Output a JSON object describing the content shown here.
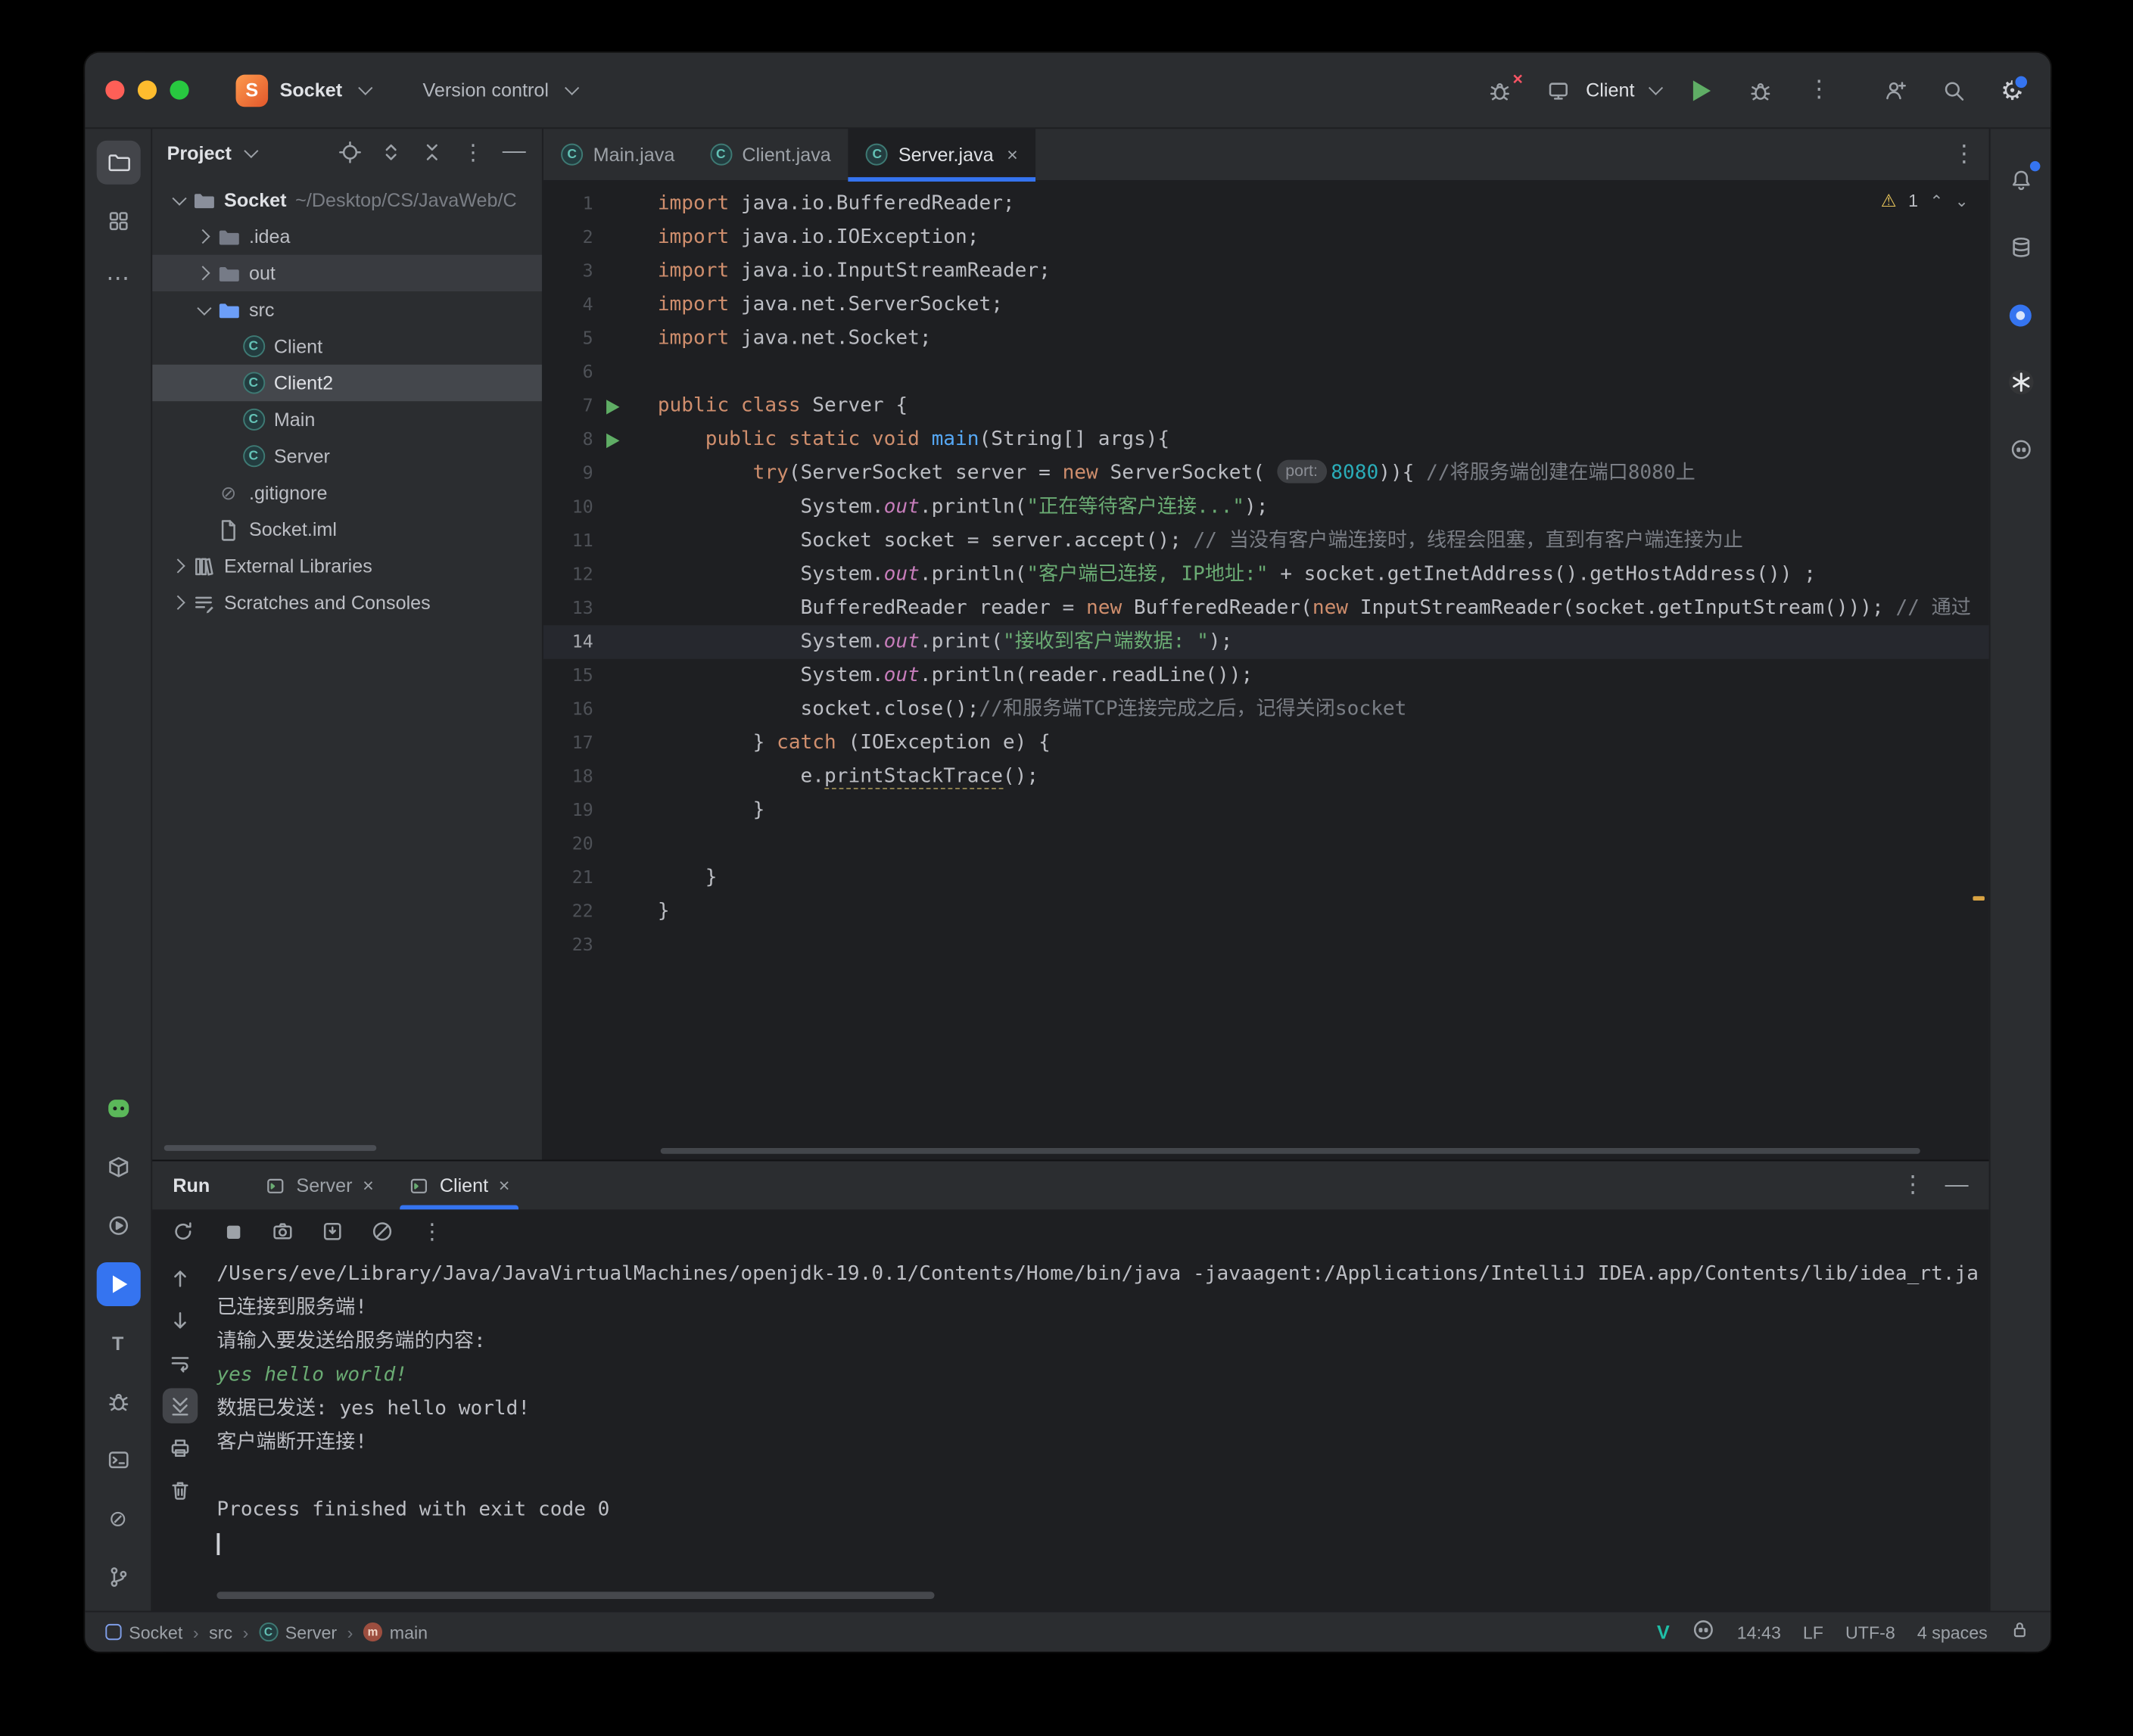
{
  "titlebar": {
    "project": "Socket",
    "vcs": "Version control",
    "run_config": "Client"
  },
  "stripes": {
    "left_top": [
      {
        "name": "project-tool-button",
        "icon": "folder-tool",
        "active": "gray"
      },
      {
        "name": "structure-tool-button",
        "icon": "structure"
      },
      {
        "name": "more-tools-button",
        "icon": "more-h"
      }
    ],
    "left_bottom": [
      {
        "name": "ai-assistant-icon",
        "icon": "mascot"
      },
      {
        "name": "dependencies-icon",
        "icon": "box"
      },
      {
        "name": "services-tool-button",
        "icon": "play-circle"
      },
      {
        "name": "run-tool-button",
        "icon": "play-solid",
        "active": "blue"
      },
      {
        "name": "todo-tool-button",
        "icon": "letter-t"
      },
      {
        "name": "debug-tool-button",
        "icon": "bug"
      },
      {
        "name": "terminal-tool-button",
        "icon": "terminal"
      },
      {
        "name": "problems-tool-button",
        "icon": "problem"
      },
      {
        "name": "git-tool-button",
        "icon": "branch"
      }
    ],
    "right": [
      {
        "name": "notifications-button",
        "icon": "bell",
        "badge": true
      },
      {
        "name": "database-tool-button",
        "icon": "database"
      },
      {
        "name": "plugin-blue-icon",
        "icon": "blue-circle"
      },
      {
        "name": "ai-chat-plugin-icon",
        "icon": "openai"
      },
      {
        "name": "copilot-plugin-icon",
        "icon": "copilot"
      }
    ]
  },
  "project_panel": {
    "title": "Project",
    "header_icons": [
      {
        "name": "locate-file-button",
        "icon": "target"
      },
      {
        "name": "expand-all-button",
        "icon": "expand"
      },
      {
        "name": "collapse-all-button",
        "icon": "collapse"
      },
      {
        "name": "project-options-button",
        "icon": "more-v"
      },
      {
        "name": "hide-panel-button",
        "icon": "minus"
      }
    ],
    "tree": [
      {
        "label": "Socket",
        "suffix": "~/Desktop/CS/JavaWeb/C",
        "depth": 0,
        "chevron": "open",
        "icon": "folder-root",
        "bold": true
      },
      {
        "label": ".idea",
        "depth": 1,
        "chevron": "closed",
        "icon": "folder"
      },
      {
        "label": "out",
        "depth": 1,
        "chevron": "closed",
        "icon": "folder",
        "state": "hover"
      },
      {
        "label": "src",
        "depth": 1,
        "chevron": "open",
        "icon": "folder-src"
      },
      {
        "label": "Client",
        "depth": 2,
        "icon": "class"
      },
      {
        "label": "Client2",
        "depth": 2,
        "icon": "class",
        "state": "selected"
      },
      {
        "label": "Main",
        "depth": 2,
        "icon": "class"
      },
      {
        "label": "Server",
        "depth": 2,
        "icon": "class"
      },
      {
        "label": ".gitignore",
        "depth": 1,
        "icon": "ignore"
      },
      {
        "label": "Socket.iml",
        "depth": 1,
        "icon": "file"
      },
      {
        "label": "External Libraries",
        "depth": 0,
        "chevron": "closed",
        "icon": "libraries"
      },
      {
        "label": "Scratches and Consoles",
        "depth": 0,
        "chevron": "closed",
        "icon": "scratches"
      }
    ]
  },
  "editor": {
    "tabs": [
      {
        "label": "Main.java",
        "icon": "class"
      },
      {
        "label": "Client.java",
        "icon": "class"
      },
      {
        "label": "Server.java",
        "icon": "class",
        "active": true,
        "closable": true
      }
    ],
    "warning_count": "1",
    "code": {
      "current_line": 14,
      "run_lines": [
        7,
        8
      ],
      "lines": [
        [
          [
            "k",
            "import "
          ],
          [
            "p",
            "java.io.BufferedReader;"
          ]
        ],
        [
          [
            "k",
            "import "
          ],
          [
            "p",
            "java.io.IOException;"
          ]
        ],
        [
          [
            "k",
            "import "
          ],
          [
            "p",
            "java.io.InputStreamReader;"
          ]
        ],
        [
          [
            "k",
            "import "
          ],
          [
            "p",
            "java.net.ServerSocket;"
          ]
        ],
        [
          [
            "k",
            "import "
          ],
          [
            "p",
            "java.net.Socket;"
          ]
        ],
        [],
        [
          [
            "k",
            "public class "
          ],
          [
            "p",
            "Server {"
          ]
        ],
        [
          [
            "p",
            "    "
          ],
          [
            "k",
            "public static void "
          ],
          [
            "d",
            "main"
          ],
          [
            "p",
            "(String[] args){"
          ]
        ],
        [
          [
            "p",
            "        "
          ],
          [
            "k",
            "try"
          ],
          [
            "p",
            "(ServerSocket server = "
          ],
          [
            "k",
            "new"
          ],
          [
            "p",
            " ServerSocket( "
          ],
          [
            "h",
            "port:"
          ],
          [
            "n",
            "8080"
          ],
          [
            "p",
            ")){ "
          ],
          [
            "c",
            "//将服务端创建在端口8080上"
          ]
        ],
        [
          [
            "p",
            "            System."
          ],
          [
            "f",
            "out"
          ],
          [
            "p",
            ".println("
          ],
          [
            "s",
            "\"正在等待客户连接...\""
          ],
          [
            "p",
            ");"
          ]
        ],
        [
          [
            "p",
            "            Socket socket = server.accept(); "
          ],
          [
            "c",
            "// 当没有客户端连接时，线程会阻塞，直到有客户端连接为止"
          ]
        ],
        [
          [
            "p",
            "            System."
          ],
          [
            "f",
            "out"
          ],
          [
            "p",
            ".println("
          ],
          [
            "s",
            "\"客户端已连接, IP地址:\""
          ],
          [
            "p",
            " + socket.getInetAddress().getHostAddress()) ;"
          ]
        ],
        [
          [
            "p",
            "            BufferedReader reader = "
          ],
          [
            "k",
            "new"
          ],
          [
            "p",
            " BufferedReader("
          ],
          [
            "k",
            "new"
          ],
          [
            "p",
            " InputStreamReader(socket.getInputStream())); "
          ],
          [
            "c",
            "// 通过"
          ]
        ],
        [
          [
            "p",
            "            System."
          ],
          [
            "f",
            "out"
          ],
          [
            "p",
            ".print("
          ],
          [
            "s",
            "\"接收到客户端数据: \""
          ],
          [
            "p",
            ");"
          ]
        ],
        [
          [
            "p",
            "            System."
          ],
          [
            "f",
            "out"
          ],
          [
            "p",
            ".println(reader.readLine());"
          ]
        ],
        [
          [
            "p",
            "            socket.close();"
          ],
          [
            "c",
            "//和服务端TCP连接完成之后，记得关闭socket"
          ]
        ],
        [
          [
            "p",
            "        } "
          ],
          [
            "k",
            "catch"
          ],
          [
            "p",
            " (IOException e) {"
          ]
        ],
        [
          [
            "p",
            "            e."
          ],
          [
            "u",
            "printStackTrace"
          ],
          [
            "p",
            "();"
          ]
        ],
        [
          [
            "p",
            "        }"
          ]
        ],
        [],
        [
          [
            "p",
            "    }"
          ]
        ],
        [
          [
            "p",
            "}"
          ]
        ],
        []
      ]
    }
  },
  "run_panel": {
    "label": "Run",
    "tabs": [
      {
        "label": "Server",
        "closable": true
      },
      {
        "label": "Client",
        "active": true,
        "closable": true
      }
    ],
    "toolbar": [
      {
        "name": "rerun-button",
        "icon": "rerun"
      },
      {
        "name": "stop-button",
        "icon": "stop"
      },
      {
        "name": "thread-dump-button",
        "icon": "camera"
      },
      {
        "name": "dump-button",
        "icon": "import"
      },
      {
        "name": "clear-output-button",
        "icon": "no-edit"
      },
      {
        "name": "run-more-button",
        "icon": "more-v"
      }
    ],
    "console_toolbar": [
      {
        "name": "prev-trace-button",
        "icon": "arrow-up"
      },
      {
        "name": "next-trace-button",
        "icon": "arrow-down"
      },
      {
        "name": "softwrap-button",
        "icon": "softwrap"
      },
      {
        "name": "scroll-end-button",
        "icon": "scroll-end",
        "active": true
      },
      {
        "name": "print-button",
        "icon": "printer"
      },
      {
        "name": "clear-console-button",
        "icon": "trash"
      }
    ],
    "console_lines": [
      {
        "style": "out",
        "text": "/Users/eve/Library/Java/JavaVirtualMachines/openjdk-19.0.1/Contents/Home/bin/java -javaagent:/Applications/IntelliJ IDEA.app/Contents/lib/idea_rt.ja"
      },
      {
        "style": "out",
        "text": "已连接到服务端!"
      },
      {
        "style": "out",
        "text": "请输入要发送给服务端的内容:"
      },
      {
        "style": "input",
        "text": "yes hello world!"
      },
      {
        "style": "out",
        "text": "数据已发送: yes hello world!"
      },
      {
        "style": "out",
        "text": "客户端断开连接!"
      },
      {
        "style": "out",
        "text": ""
      },
      {
        "style": "out",
        "text": "Process finished with exit code 0"
      },
      {
        "style": "caret",
        "text": ""
      }
    ]
  },
  "status_bar": {
    "crumbs": [
      {
        "label": "Socket",
        "icon": "module"
      },
      {
        "label": "src"
      },
      {
        "label": "Server",
        "icon": "class"
      },
      {
        "label": "main",
        "icon": "method"
      }
    ],
    "caret": "14:43",
    "line_ending": "LF",
    "encoding": "UTF-8",
    "indent": "4 spaces"
  }
}
